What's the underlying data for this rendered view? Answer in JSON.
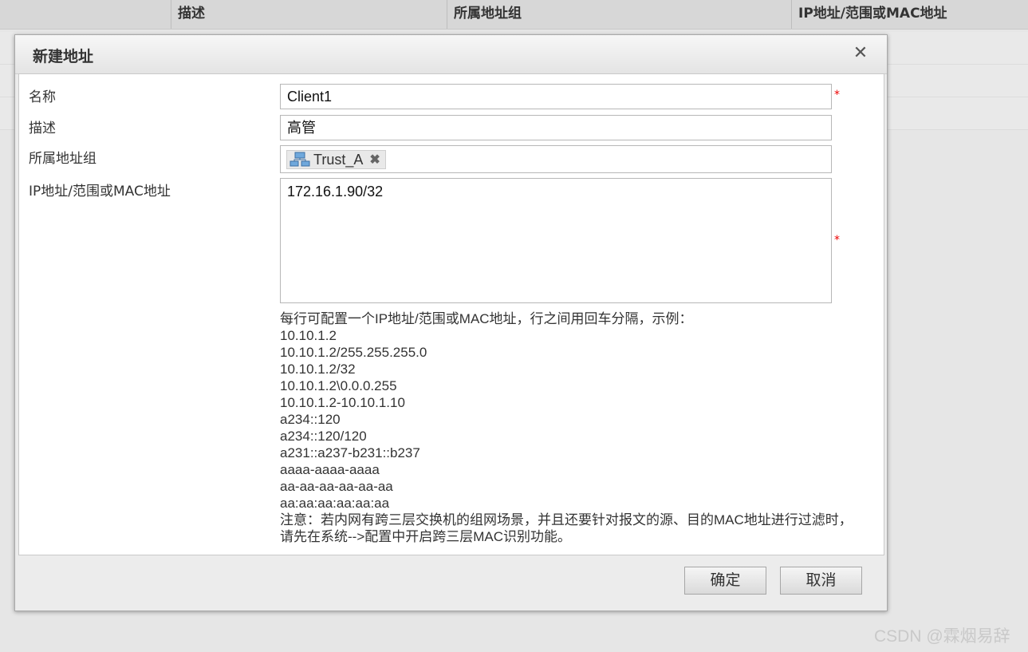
{
  "background_table": {
    "columns": [
      "描述",
      "所属地址组",
      "IP地址/范围或MAC地址"
    ]
  },
  "dialog": {
    "title": "新建地址",
    "close_icon": "close-icon",
    "fields": {
      "name": {
        "label": "名称",
        "value": "Client1",
        "required": "*"
      },
      "description": {
        "label": "描述",
        "value": "高管"
      },
      "group": {
        "label": "所属地址组",
        "tag": "Trust_A",
        "tag_icon": "network-group-icon",
        "remove_glyph": "✖"
      },
      "address": {
        "label": "IP地址/范围或MAC地址",
        "value": "172.16.1.90/32",
        "required": "*"
      }
    },
    "hint": {
      "intro": "每行可配置一个IP地址/范围或MAC地址，行之间用回车分隔，示例：",
      "examples": [
        "10.10.1.2",
        "10.10.1.2/255.255.255.0",
        "10.10.1.2/32",
        "10.10.1.2\\0.0.0.255",
        "10.10.1.2-10.10.1.10",
        "a234::120",
        "a234::120/120",
        "a231::a237-b231::b237",
        "aaaa-aaaa-aaaa",
        "aa-aa-aa-aa-aa-aa",
        "aa:aa:aa:aa:aa:aa"
      ],
      "note": "注意：若内网有跨三层交换机的组网场景，并且还要针对报文的源、目的MAC地址进行过滤时，请先在系统-->配置中开启跨三层MAC识别功能。"
    },
    "buttons": {
      "ok": "确定",
      "cancel": "取消"
    }
  },
  "watermark": "CSDN @霖烟易辞"
}
